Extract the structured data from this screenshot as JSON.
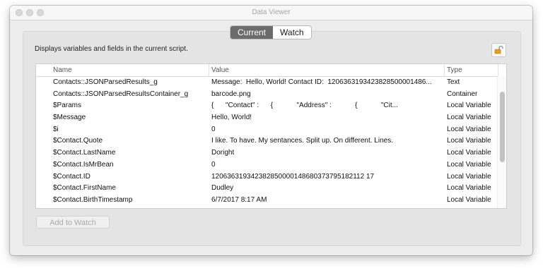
{
  "window": {
    "title": "Data Viewer"
  },
  "tabs": [
    {
      "label": "Current",
      "active": true
    },
    {
      "label": "Watch",
      "active": false
    }
  ],
  "description": "Displays variables and fields in the current script.",
  "lock_icon": "unlocked-padlock-icon",
  "table": {
    "columns": [
      "Name",
      "Value",
      "Type"
    ],
    "rows": [
      {
        "name": "Contacts::JSONParsedResults_g",
        "value": "Message:  Hello, World! Contact ID:  1206363193423828500001486...",
        "type": "Text"
      },
      {
        "name": "Contacts::JSONParsedResultsContainer_g",
        "value": "barcode.png",
        "type": "Container"
      },
      {
        "name": "$Params",
        "value": "{      \"Contact\" :      {            \"Address\" :            {            \"Cit...",
        "type": "Local Variable"
      },
      {
        "name": "$Message",
        "value": "Hello, World!",
        "type": "Local Variable"
      },
      {
        "name": "$i",
        "value": "0",
        "type": "Local Variable"
      },
      {
        "name": "$Contact.Quote",
        "value": "I like. To have. My sentances. Split up. On different. Lines.",
        "type": "Local Variable"
      },
      {
        "name": "$Contact.LastName",
        "value": "Doright",
        "type": "Local Variable"
      },
      {
        "name": "$Contact.IsMrBean",
        "value": "0",
        "type": "Local Variable"
      },
      {
        "name": "$Contact.ID",
        "value": "120636319342382850000148680373795182112 17",
        "type": "Local Variable"
      },
      {
        "name": "$Contact.FirstName",
        "value": "Dudley",
        "type": "Local Variable"
      },
      {
        "name": "$Contact.BirthTimestamp",
        "value": "6/7/2017 8:17 AM",
        "type": "Local Variable"
      }
    ]
  },
  "add_button": "Add to Watch",
  "colors": {
    "active_tab": "#6b6b6b",
    "window_bg": "#ececec"
  }
}
